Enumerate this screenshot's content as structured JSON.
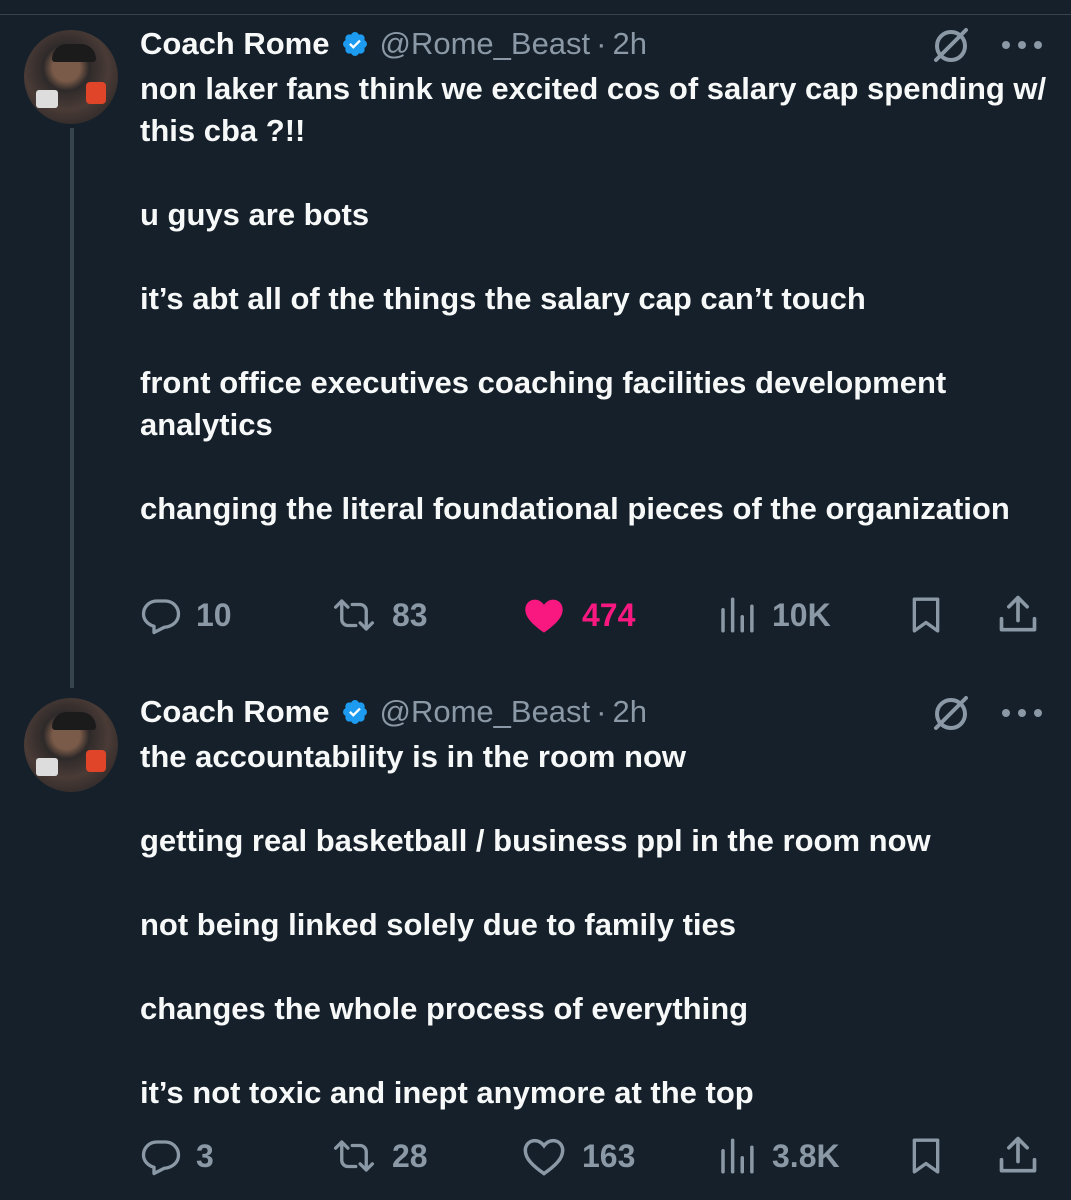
{
  "posts": [
    {
      "author_name": "Coach Rome",
      "handle": "@Rome_Beast",
      "separator": "·",
      "time": "2h",
      "paragraphs": [
        "non laker fans think we excited cos of salary cap spending w/ this cba ?!!",
        "u guys are bots",
        "it’s abt all of the things the salary cap can’t touch",
        "front office executives coaching facilities development analytics",
        "changing the literal foundational pieces of the organization"
      ],
      "replies": "10",
      "reposts": "83",
      "likes": "474",
      "liked": true,
      "views": "10K"
    },
    {
      "author_name": "Coach Rome",
      "handle": "@Rome_Beast",
      "separator": "·",
      "time": "2h",
      "paragraphs": [
        "the accountability is in the room now",
        "getting real basketball / business ppl in the room now",
        "not being linked solely due to family ties",
        "changes the whole process of everything",
        "it’s not toxic and inept anymore at the top"
      ],
      "replies": "3",
      "reposts": "28",
      "likes": "163",
      "liked": false,
      "views": "3.8K"
    }
  ],
  "icons": {
    "verified": "verified-badge-icon",
    "grok": "grok-icon",
    "more": "more-icon",
    "reply": "reply-icon",
    "repost": "repost-icon",
    "like": "heart-icon",
    "views": "views-icon",
    "bookmark": "bookmark-icon",
    "share": "share-icon"
  },
  "colors": {
    "background": "#15202b",
    "text": "#f7f9f9",
    "muted": "#8b98a5",
    "verified": "#1d9bf0",
    "like_active": "#f91880"
  }
}
